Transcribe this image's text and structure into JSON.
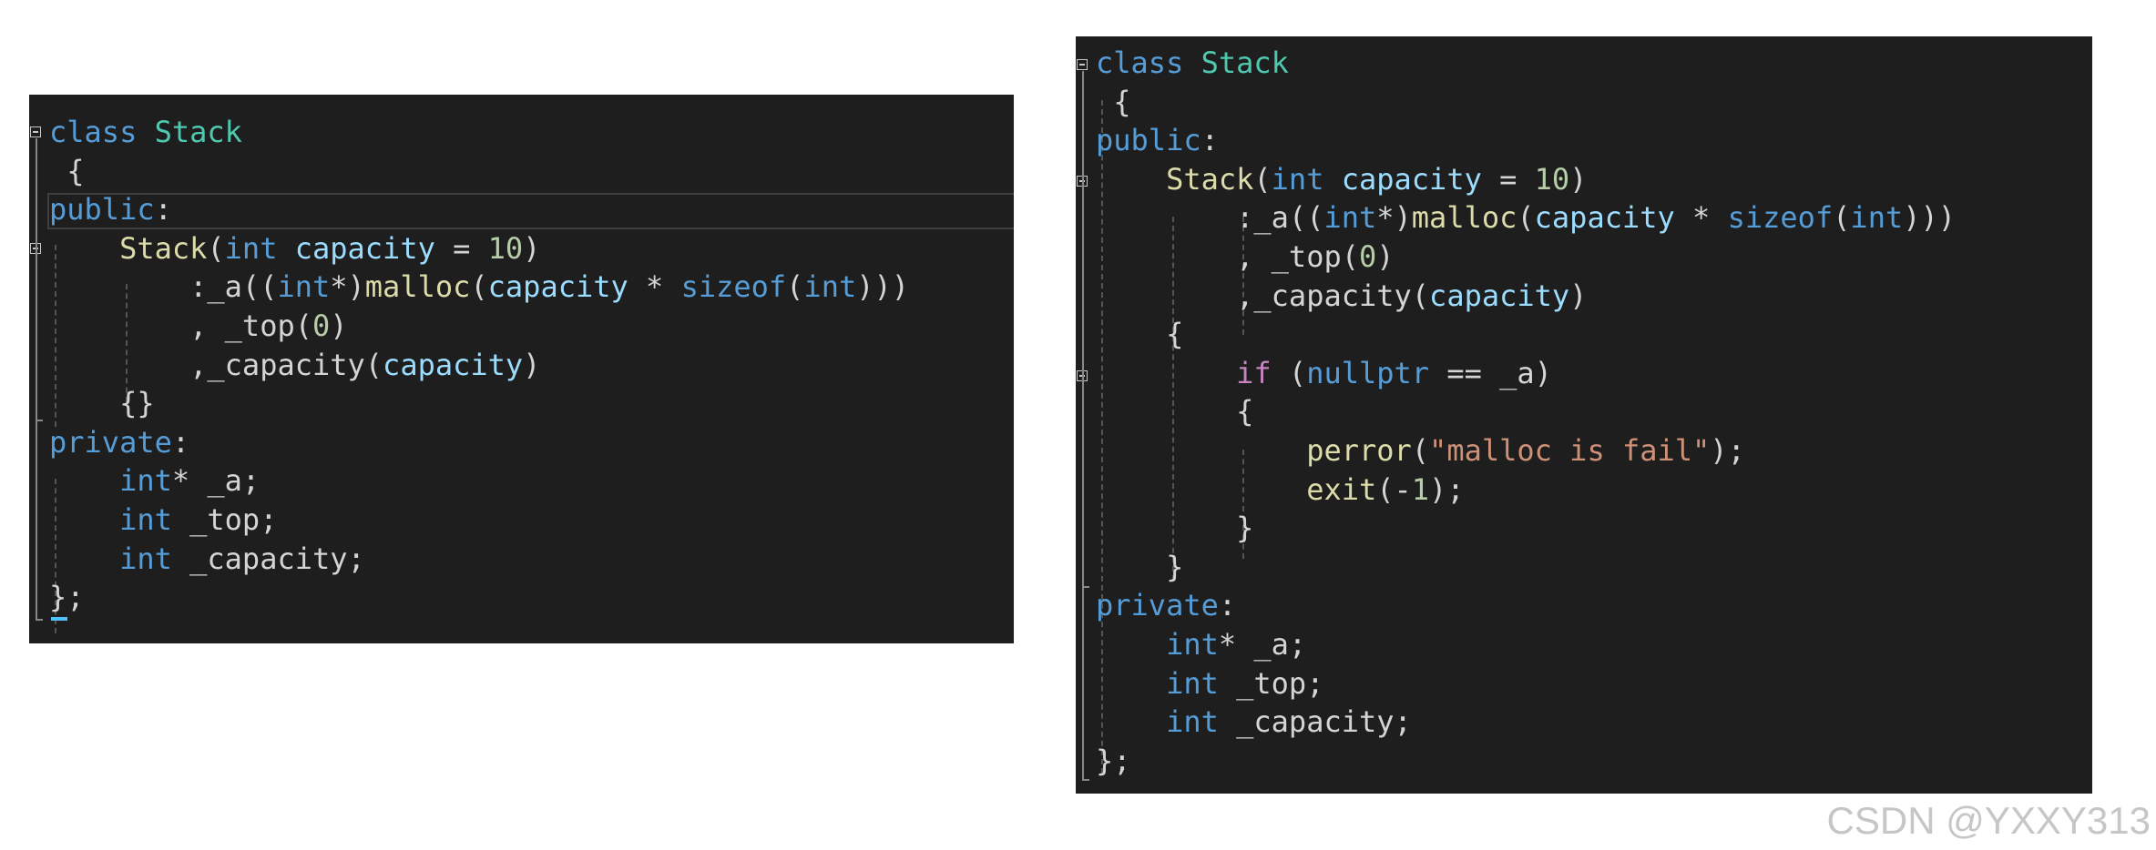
{
  "left_panel": {
    "lines": [
      [
        {
          "c": "k",
          "t": "class"
        },
        {
          "c": "",
          "t": " "
        },
        {
          "c": "t",
          "t": "Stack"
        }
      ],
      [
        {
          "c": "",
          "t": " {"
        }
      ],
      [
        {
          "c": "k",
          "t": "public"
        },
        {
          "c": "",
          "t": ":"
        }
      ],
      [
        {
          "c": "",
          "t": "    "
        },
        {
          "c": "f",
          "t": "Stack"
        },
        {
          "c": "",
          "t": "("
        },
        {
          "c": "k",
          "t": "int"
        },
        {
          "c": "",
          "t": " "
        },
        {
          "c": "p",
          "t": "capacity"
        },
        {
          "c": "",
          "t": " = "
        },
        {
          "c": "n",
          "t": "10"
        },
        {
          "c": "",
          "t": ")"
        }
      ],
      [
        {
          "c": "",
          "t": "        :_a(("
        },
        {
          "c": "k",
          "t": "int"
        },
        {
          "c": "",
          "t": "*)"
        },
        {
          "c": "f",
          "t": "malloc"
        },
        {
          "c": "",
          "t": "("
        },
        {
          "c": "p",
          "t": "capacity"
        },
        {
          "c": "",
          "t": " * "
        },
        {
          "c": "k",
          "t": "sizeof"
        },
        {
          "c": "",
          "t": "("
        },
        {
          "c": "k",
          "t": "int"
        },
        {
          "c": "",
          "t": ")))"
        }
      ],
      [
        {
          "c": "",
          "t": "        , _top("
        },
        {
          "c": "n",
          "t": "0"
        },
        {
          "c": "",
          "t": ")"
        }
      ],
      [
        {
          "c": "",
          "t": "        ,_capacity("
        },
        {
          "c": "p",
          "t": "capacity"
        },
        {
          "c": "",
          "t": ")"
        }
      ],
      [
        {
          "c": "",
          "t": "    {}"
        }
      ],
      [
        {
          "c": "k",
          "t": "private"
        },
        {
          "c": "",
          "t": ":"
        }
      ],
      [
        {
          "c": "",
          "t": "    "
        },
        {
          "c": "k",
          "t": "int"
        },
        {
          "c": "",
          "t": "* _a;"
        }
      ],
      [
        {
          "c": "",
          "t": "    "
        },
        {
          "c": "k",
          "t": "int"
        },
        {
          "c": "",
          "t": " _top;"
        }
      ],
      [
        {
          "c": "",
          "t": "    "
        },
        {
          "c": "k",
          "t": "int"
        },
        {
          "c": "",
          "t": " _capacity;"
        }
      ],
      [
        {
          "c": "",
          "t": "};"
        }
      ]
    ]
  },
  "right_panel": {
    "lines": [
      [
        {
          "c": "k",
          "t": "class"
        },
        {
          "c": "",
          "t": " "
        },
        {
          "c": "t",
          "t": "Stack"
        }
      ],
      [
        {
          "c": "",
          "t": " {"
        }
      ],
      [
        {
          "c": "k",
          "t": "public"
        },
        {
          "c": "",
          "t": ":"
        }
      ],
      [
        {
          "c": "",
          "t": "    "
        },
        {
          "c": "f",
          "t": "Stack"
        },
        {
          "c": "",
          "t": "("
        },
        {
          "c": "k",
          "t": "int"
        },
        {
          "c": "",
          "t": " "
        },
        {
          "c": "p",
          "t": "capacity"
        },
        {
          "c": "",
          "t": " = "
        },
        {
          "c": "n",
          "t": "10"
        },
        {
          "c": "",
          "t": ")"
        }
      ],
      [
        {
          "c": "",
          "t": "        :_a(("
        },
        {
          "c": "k",
          "t": "int"
        },
        {
          "c": "",
          "t": "*)"
        },
        {
          "c": "f",
          "t": "malloc"
        },
        {
          "c": "",
          "t": "("
        },
        {
          "c": "p",
          "t": "capacity"
        },
        {
          "c": "",
          "t": " * "
        },
        {
          "c": "k",
          "t": "sizeof"
        },
        {
          "c": "",
          "t": "("
        },
        {
          "c": "k",
          "t": "int"
        },
        {
          "c": "",
          "t": ")))"
        }
      ],
      [
        {
          "c": "",
          "t": "        , _top("
        },
        {
          "c": "n",
          "t": "0"
        },
        {
          "c": "",
          "t": ")"
        }
      ],
      [
        {
          "c": "",
          "t": "        ,_capacity("
        },
        {
          "c": "p",
          "t": "capacity"
        },
        {
          "c": "",
          "t": ")"
        }
      ],
      [
        {
          "c": "",
          "t": "    {"
        }
      ],
      [
        {
          "c": "",
          "t": "        "
        },
        {
          "c": "c",
          "t": "if"
        },
        {
          "c": "",
          "t": " ("
        },
        {
          "c": "k",
          "t": "nullptr"
        },
        {
          "c": "",
          "t": " == _a)"
        }
      ],
      [
        {
          "c": "",
          "t": "        {"
        }
      ],
      [
        {
          "c": "",
          "t": "            "
        },
        {
          "c": "f",
          "t": "perror"
        },
        {
          "c": "",
          "t": "("
        },
        {
          "c": "s",
          "t": "\"malloc is fail\""
        },
        {
          "c": "",
          "t": ");"
        }
      ],
      [
        {
          "c": "",
          "t": "            "
        },
        {
          "c": "f",
          "t": "exit"
        },
        {
          "c": "",
          "t": "(-"
        },
        {
          "c": "n",
          "t": "1"
        },
        {
          "c": "",
          "t": ");"
        }
      ],
      [
        {
          "c": "",
          "t": "        }"
        }
      ],
      [
        {
          "c": "",
          "t": "    }"
        }
      ],
      [
        {
          "c": "k",
          "t": "private"
        },
        {
          "c": "",
          "t": ":"
        }
      ],
      [
        {
          "c": "",
          "t": "    "
        },
        {
          "c": "k",
          "t": "int"
        },
        {
          "c": "",
          "t": "* _a;"
        }
      ],
      [
        {
          "c": "",
          "t": "    "
        },
        {
          "c": "k",
          "t": "int"
        },
        {
          "c": "",
          "t": " _top;"
        }
      ],
      [
        {
          "c": "",
          "t": "    "
        },
        {
          "c": "k",
          "t": "int"
        },
        {
          "c": "",
          "t": " _capacity;"
        }
      ],
      [
        {
          "c": "",
          "t": "};"
        }
      ]
    ]
  },
  "watermark": "CSDN @YXXY313"
}
